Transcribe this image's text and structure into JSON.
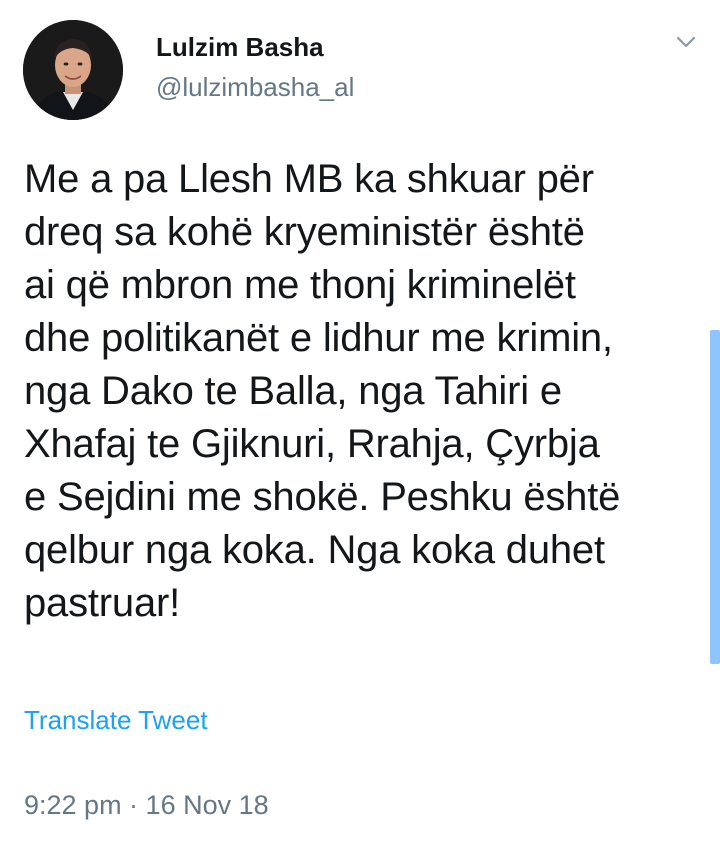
{
  "author": {
    "display_name": "Lulzim Basha",
    "handle": "@lulzimbasha_al",
    "avatar_icon": "profile-photo"
  },
  "tweet": {
    "text": "Me a pa Llesh MB ka shkuar për\ndreq sa kohë kryeministër është\nai që mbron me thonj kriminelët\ndhe politikanët e lidhur me krimin,\nnga Dako te Balla, nga Tahiri e\nXhafaj te Gjiknuri, Rrahja, Çyrbja\ne Sejdini me shokë. Peshku është\nqelbur nga koka. Nga koka duhet\npastruar!",
    "translate_label": "Translate Tweet",
    "timestamp": "9:22 pm · 16 Nov 18"
  },
  "icons": {
    "menu": "chevron-down-icon"
  },
  "colors": {
    "link": "#1da1f2",
    "secondary_text": "#657786",
    "primary_text": "#14171a",
    "scrollbar": "#8ec5ff"
  }
}
